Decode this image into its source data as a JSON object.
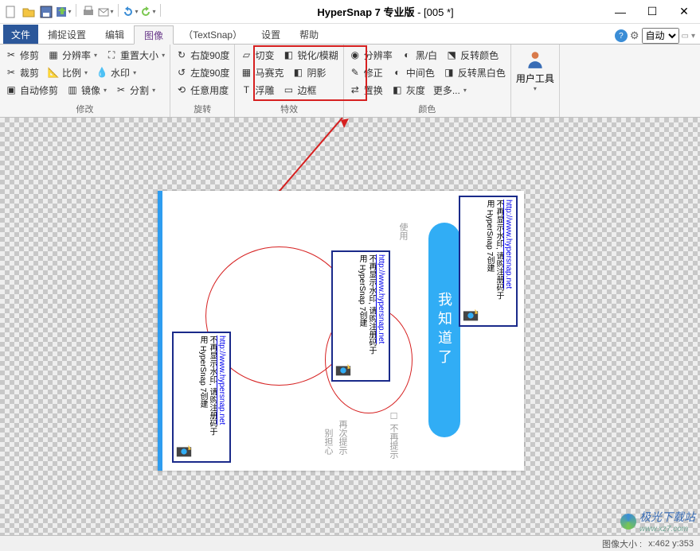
{
  "title": {
    "app": "HyperSnap 7 专业版",
    "doc": "[005 *]"
  },
  "tabs": {
    "file": "文件",
    "capture": "捕捉设置",
    "edit": "编辑",
    "image": "图像",
    "textsnap": "（TextSnap）",
    "settings": "设置",
    "help": "帮助",
    "auto": "自动"
  },
  "ribbon": {
    "modify": {
      "title": "修改",
      "trim": "修剪",
      "crop": "裁剪",
      "autotrim": "自动修剪",
      "resolution": "分辨率",
      "scale": "比例",
      "mirror": "镜像",
      "resize": "重置大小",
      "watermark": "水印",
      "split": "分割"
    },
    "rotate": {
      "title": "旋转",
      "right90": "右旋90度",
      "left90": "左旋90度",
      "any": "任意用度"
    },
    "effects": {
      "title": "特效",
      "shear": "切变",
      "mosaic": "马赛克",
      "emboss": "浮雕",
      "sharpen": "锐化/模糊",
      "shadow": "阴影",
      "border": "边框"
    },
    "color": {
      "title": "颜色",
      "resolution": "分辨率",
      "correct": "修正",
      "replace": "置换",
      "bw": "黑/白",
      "middle": "中间色",
      "gray": "灰度",
      "invert": "反转颜色",
      "invertbw": "反转黑白色",
      "more": "更多..."
    },
    "user": {
      "title": "用户工具"
    }
  },
  "canvas": {
    "button": "我知道了",
    "checkbox": "不再提示",
    "txt1": "别担心",
    "txt2": "再次提示",
    "txt3": "使用",
    "stamp": {
      "l1": "用 HyperSnap 7创建",
      "l2": "不再显示水印, 请购注册码于",
      "l3": "http://www.hypersnap.net"
    }
  },
  "status": {
    "size": "图像大小 :",
    "coord": "x:462    y:353"
  },
  "watermark": {
    "text": "极光下载站",
    "url": "www.xz7.com"
  }
}
